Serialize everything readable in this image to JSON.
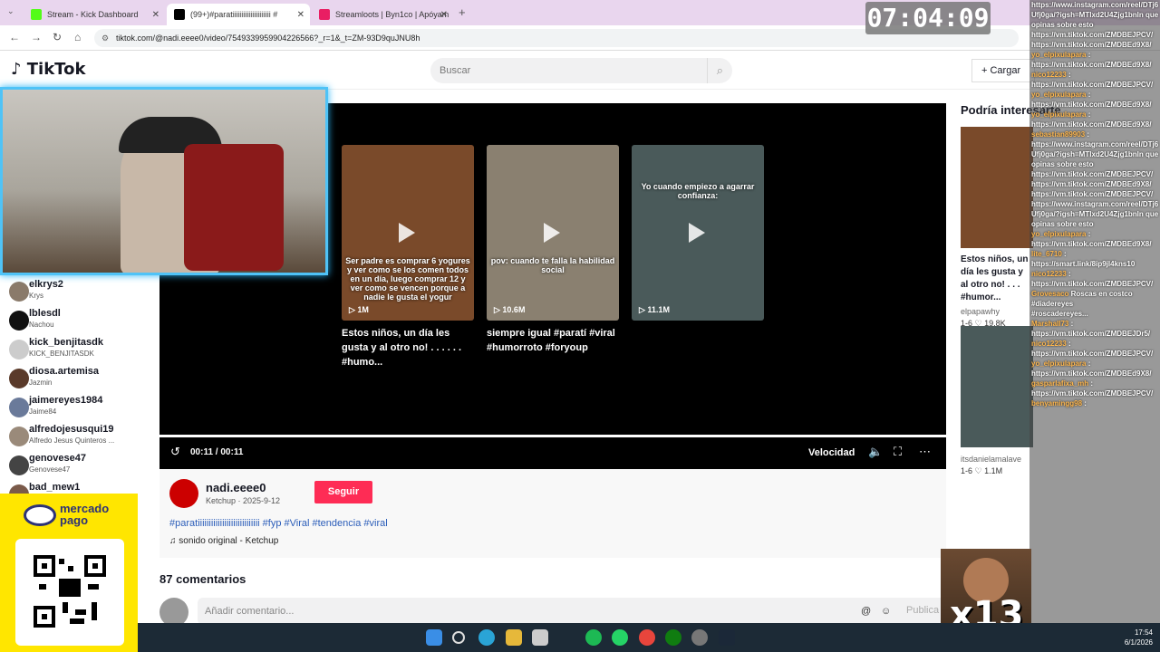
{
  "browser": {
    "tabs": [
      {
        "label": "Stream - Kick Dashboard",
        "color": "#53fc18"
      },
      {
        "label": "(99+)#paratiiiiiiiiiiiiiiiiiiiii #",
        "color": "#000000"
      },
      {
        "label": "Streamloots | Byn1co | Apóyam",
        "color": "#e91e63"
      }
    ],
    "new_tab": "+",
    "url": "tiktok.com/@nadi.eeee0/video/7549339959904226566?_r=1&_t=ZM-93D9quJNU8h"
  },
  "clock": "07:04:09",
  "tiktok": {
    "logo": "TikTok",
    "search_placeholder": "Buscar",
    "upload_label": "Cargar",
    "sidebar_users": [
      {
        "name": "elkrys2",
        "sub": "Krys"
      },
      {
        "name": "lblesdl",
        "sub": "Nachou"
      },
      {
        "name": "kick_benjitasdk",
        "sub": "KICK_BENJITASDK"
      },
      {
        "name": "diosa.artemisa",
        "sub": "Jazmin"
      },
      {
        "name": "jaimereyes1984",
        "sub": "Jaime84"
      },
      {
        "name": "alfredojesusqui19",
        "sub": "Alfredo Jesus Quinteros ..."
      },
      {
        "name": "genovese47",
        "sub": "Genovese47"
      },
      {
        "name": "bad_mew1",
        "sub": ""
      }
    ],
    "player_cards": [
      {
        "caption": "Ser padre es comprar 6 yogures y ver como se los comen todos en un día, luego comprar 12 y ver como se vencen porque a nadie le gusta el yogur",
        "views": "1M",
        "title": "Estos niños, un día les gusta y al otro no! . . . . . . #humo...",
        "color": "#7a4a2a"
      },
      {
        "caption": "pov: cuando te falla la habilidad social",
        "views": "10.6M",
        "title": "siempre igual #paratí #viral #humorroto #foryoup",
        "color": "#8a8070"
      },
      {
        "caption": "Yo cuando empiezo a agarrar confianza:",
        "views": "11.1M",
        "title": "",
        "color": "#4a5a5a"
      }
    ],
    "time": "00:11 / 00:11",
    "speed_label": "Velocidad",
    "author": "nadi.eeee0",
    "author_sub": "Ketchup · 2025-9-12",
    "follow_label": "Seguir",
    "hashtags": "#paratiiiiiiiiiiiiiiiiiiiiiiiiiiii #fyp #Viral #tendencia #viral",
    "sound": "sonido original - Ketchup",
    "comments_count": "87 comentarios",
    "comment_placeholder": "Añadir comentario...",
    "publish_label": "Publica",
    "suggest_heading": "Podría interesarte",
    "suggestions": [
      {
        "title": "Estos niños, un día les gusta y al otro no! . . . #humor...",
        "user": "elpapawhy",
        "date": "1-6",
        "likes": "19.8K",
        "duration": "00:07"
      },
      {
        "title": "",
        "user": "itsdanielamalave",
        "date": "1-6",
        "likes": "1.1M",
        "duration": ""
      }
    ]
  },
  "chat": [
    {
      "u": "",
      "t": "https://www.instagram.com/reel/DTj6"
    },
    {
      "u": "",
      "t": "Ufj0ga/?igsh=MTlxd2U4Zjg1bnln que"
    },
    {
      "u": "",
      "t": "opinas sobre esto"
    },
    {
      "u": "",
      "t": "https://vm.tiktok.com/ZMDBEJPCV/"
    },
    {
      "u": "",
      "t": "https://vm.tiktok.com/ZMDBEd9X8/"
    },
    {
      "u": "yo_elpixulapara",
      "t": ":"
    },
    {
      "u": "",
      "t": "https://vm.tiktok.com/ZMDBEd9X8/"
    },
    {
      "u": "nico12233",
      "t": ":"
    },
    {
      "u": "",
      "t": "https://vm.tiktok.com/ZMDBEJPCV/"
    },
    {
      "u": "yo_elpixulapara",
      "t": ":"
    },
    {
      "u": "",
      "t": "https://vm.tiktok.com/ZMDBEd9X8/"
    },
    {
      "u": "yo_elpixulapara",
      "t": ":"
    },
    {
      "u": "",
      "t": "https://vm.tiktok.com/ZMDBEd9X8/"
    },
    {
      "u": "sebastian89903",
      "t": ":"
    },
    {
      "u": "",
      "t": "https://www.instagram.com/reel/DTj6"
    },
    {
      "u": "",
      "t": "Ufj0ga/?igsh=MTlxd2U4Zjg1bnln que"
    },
    {
      "u": "",
      "t": "opinas sobre esto"
    },
    {
      "u": "",
      "t": "https://vm.tiktok.com/ZMDBEJPCV/"
    },
    {
      "u": "",
      "t": "https://vm.tiktok.com/ZMDBEd9X8/"
    },
    {
      "u": "",
      "t": "https://vm.tiktok.com/ZMDBEJPCV/"
    },
    {
      "u": "",
      "t": "https://www.instagram.com/reel/DTj6"
    },
    {
      "u": "",
      "t": "Ufj0ga/?igsh=MTlxd2U4Zjg1bnln que"
    },
    {
      "u": "",
      "t": "opinas sobre esto"
    },
    {
      "u": "yo_elpixulapara",
      "t": ":"
    },
    {
      "u": "",
      "t": "https://vm.tiktok.com/ZMDBEd9X8/"
    },
    {
      "u": "lite_6710",
      "t": ":"
    },
    {
      "u": "",
      "t": "https://smart.link/8ip9jl4kns10"
    },
    {
      "u": "nico12233",
      "t": ":"
    },
    {
      "u": "",
      "t": "https://vm.tiktok.com/ZMDBEJPCV/"
    },
    {
      "u": "Grovesaco",
      "t": "Roscas en costco"
    },
    {
      "u": "",
      "t": "#diadereyes"
    },
    {
      "u": "",
      "t": "#roscadereyes..."
    },
    {
      "u": "Marshall73",
      "t": ":"
    },
    {
      "u": "",
      "t": "https://vm.tiktok.com/ZMDBEJDr5/"
    },
    {
      "u": "nico12233",
      "t": ":"
    },
    {
      "u": "",
      "t": "https://vm.tiktok.com/ZMDBEJPCV/"
    },
    {
      "u": "yo_elpixulapara",
      "t": ":"
    },
    {
      "u": "",
      "t": "https://vm.tiktok.com/ZMDBEd9X8/"
    },
    {
      "u": "gasparlafixa_mh",
      "t": ":"
    },
    {
      "u": "",
      "t": "https://vm.tiktok.com/ZMDBEJPCV/"
    },
    {
      "u": "benyamingg98",
      "t": ":"
    }
  ],
  "mercadopago": {
    "brand_line1": "mercado",
    "brand_line2": "pago"
  },
  "taskbar": {
    "time": "17:54",
    "date": "6/1/2026"
  },
  "overlay": {
    "multiplier": "x13"
  }
}
